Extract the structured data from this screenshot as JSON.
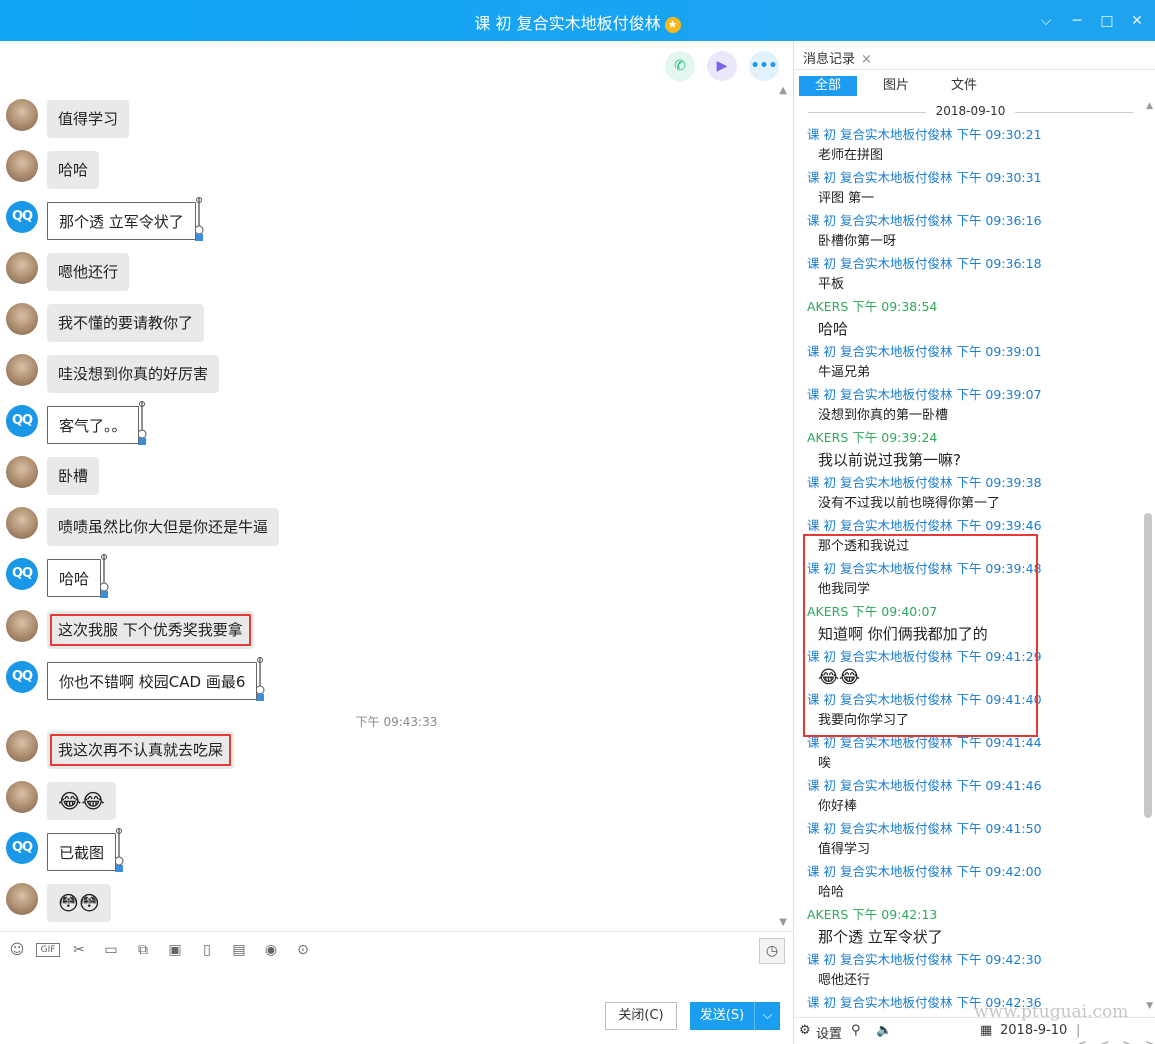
{
  "window": {
    "title": "课 初 复合实木地板付俊林",
    "star_glyph": "★",
    "minimize_glyph": "─",
    "maximize_glyph": "□",
    "close_glyph": "✕",
    "dropdown_glyph": "⌵"
  },
  "chat": {
    "actions": {
      "phone_glyph": "✆",
      "video_glyph": "▶",
      "more_glyph": "•••"
    },
    "timestamp": "下午 09:43:33",
    "avatar_qq_text": "QQ",
    "messages": [
      {
        "text": "值得学习",
        "framed": false,
        "highlight": false
      },
      {
        "text": "哈哈",
        "framed": false,
        "highlight": false
      },
      {
        "text": "那个透 立军令状了",
        "framed": true,
        "highlight": false
      },
      {
        "text": "嗯他还行",
        "framed": false,
        "highlight": false
      },
      {
        "text": "我不懂的要请教你了",
        "framed": false,
        "highlight": false
      },
      {
        "text": "哇没想到你真的好厉害",
        "framed": false,
        "highlight": false
      },
      {
        "text": "客气了。。",
        "framed": true,
        "highlight": false
      },
      {
        "text": "卧槽",
        "framed": false,
        "highlight": false
      },
      {
        "text": "啧啧虽然比你大但是你还是牛逼",
        "framed": false,
        "highlight": false
      },
      {
        "text": "哈哈",
        "framed": true,
        "highlight": false
      },
      {
        "text": "这次我服  下个优秀奖我要拿",
        "framed": false,
        "highlight": true
      },
      {
        "text": "你也不错啊  校园CAD 画最6",
        "framed": true,
        "highlight": false
      },
      {
        "text": "我这次再不认真就去吃屎",
        "framed": false,
        "highlight": true
      },
      {
        "text": "😂😂",
        "framed": false,
        "highlight": false
      },
      {
        "text": "已截图",
        "framed": true,
        "highlight": false
      },
      {
        "text": "😳😳",
        "framed": false,
        "highlight": false
      }
    ]
  },
  "input": {
    "tools": [
      "☺",
      "GIF",
      "✂",
      "▭",
      "⧉",
      "▣",
      "▯",
      "▤",
      "◉",
      "⊙"
    ],
    "history_glyph": "◷",
    "close_label": "关闭(C)",
    "send_label": "发送(S)",
    "send_arrow": "⌵"
  },
  "panel": {
    "tab_title": "消息记录",
    "tab_close": "×",
    "filters": [
      "全部",
      "图片",
      "文件"
    ],
    "date": "2018-09-10",
    "records": [
      {
        "sender": "课 初 复合实木地板付俊林",
        "time": "下午 09:30:21",
        "green": false,
        "text": "老师在拼图",
        "style": ""
      },
      {
        "sender": "课 初 复合实木地板付俊林",
        "time": "下午 09:30:31",
        "green": false,
        "text": "评图  第一",
        "style": ""
      },
      {
        "sender": "课 初 复合实木地板付俊林",
        "time": "下午 09:36:16",
        "green": false,
        "text": "卧槽你第一呀",
        "style": ""
      },
      {
        "sender": "课 初 复合实木地板付俊林",
        "time": "下午 09:36:18",
        "green": false,
        "text": "平板",
        "style": ""
      },
      {
        "sender": "AKERS",
        "time": "下午 09:38:54",
        "green": true,
        "text": "哈哈",
        "style": "big"
      },
      {
        "sender": "课 初 复合实木地板付俊林",
        "time": "下午 09:39:01",
        "green": false,
        "text": "牛逼兄弟",
        "style": ""
      },
      {
        "sender": "课 初 复合实木地板付俊林",
        "time": "下午 09:39:07",
        "green": false,
        "text": "没想到你真的第一卧槽",
        "style": ""
      },
      {
        "sender": "AKERS",
        "time": "下午 09:39:24",
        "green": true,
        "text": " 我以前说过我第一嘛?",
        "style": "big"
      },
      {
        "sender": "课 初 复合实木地板付俊林",
        "time": "下午 09:39:38",
        "green": false,
        "text": "没有不过我以前也晓得你第一了",
        "style": ""
      },
      {
        "sender": "课 初 复合实木地板付俊林",
        "time": "下午 09:39:46",
        "green": false,
        "text": "那个透和我说过",
        "style": ""
      },
      {
        "sender": "课 初 复合实木地板付俊林",
        "time": "下午 09:39:48",
        "green": false,
        "text": "他我同学",
        "style": ""
      },
      {
        "sender": "AKERS",
        "time": "下午 09:40:07",
        "green": true,
        "text": "知道啊  你们俩我都加了的",
        "style": "big"
      },
      {
        "sender": "课 初 复合实木地板付俊林",
        "time": "下午 09:41:29",
        "green": false,
        "text": "😂😂",
        "style": "emoji"
      },
      {
        "sender": "课 初 复合实木地板付俊林",
        "time": "下午 09:41:40",
        "green": false,
        "text": "我要向你学习了",
        "style": ""
      },
      {
        "sender": "课 初 复合实木地板付俊林",
        "time": "下午 09:41:44",
        "green": false,
        "text": "唉",
        "style": ""
      },
      {
        "sender": "课 初 复合实木地板付俊林",
        "time": "下午 09:41:46",
        "green": false,
        "text": "你好棒",
        "style": ""
      },
      {
        "sender": "课 初 复合实木地板付俊林",
        "time": "下午 09:41:50",
        "green": false,
        "text": "值得学习",
        "style": ""
      },
      {
        "sender": "课 初 复合实木地板付俊林",
        "time": "下午 09:42:00",
        "green": false,
        "text": "哈哈",
        "style": ""
      },
      {
        "sender": "AKERS",
        "time": "下午 09:42:13",
        "green": true,
        "text": "那个透 立军令状了",
        "style": "big"
      },
      {
        "sender": "课 初 复合实木地板付俊林",
        "time": "下午 09:42:30",
        "green": false,
        "text": "嗯他还行",
        "style": ""
      },
      {
        "sender": "课 初 复合实木地板付俊林",
        "time": "下午 09:42:36",
        "green": false,
        "text": "",
        "style": ""
      }
    ],
    "bottom": {
      "settings_glyph": "⚙",
      "settings_label": "设置",
      "search_glyph": "⚲",
      "sound_glyph": "🔈",
      "calendar_glyph": "▦",
      "date": "2018-9-10",
      "nav_glyphs": [
        "|<",
        "<",
        ">",
        ">|"
      ]
    },
    "watermark": "www.ptuguai.com"
  }
}
